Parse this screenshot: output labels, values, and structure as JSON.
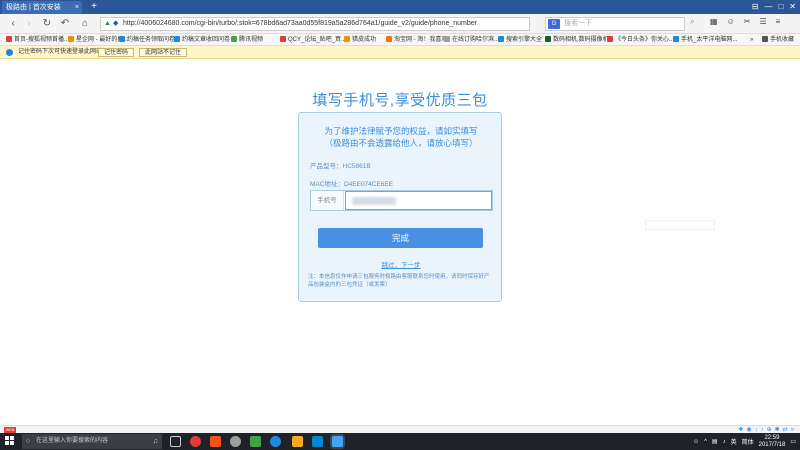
{
  "browser": {
    "tab_title": "极路由 | 首次安装",
    "tab_close": "×",
    "new_tab": "+",
    "url": "http://4006024680.com/cgi-bin/turbo/;stok=678bd6ad73aa0d55f819a5a286d764a1/guide_v2/guide/phone_number",
    "search_placeholder": "搜索一下",
    "search_engine": "G",
    "window_controls": [
      "⊟",
      "—",
      "□",
      "✕"
    ]
  },
  "bookmarks": [
    {
      "label": "首页-搜狐视频首播...",
      "color": "#e53935"
    },
    {
      "label": "星企网 - 最好的搜...",
      "color": "#fb8c00"
    },
    {
      "label": "约稿任务领取问卷",
      "color": "#1e88e5"
    },
    {
      "label": "约稿文章收回问卷",
      "color": "#1e88e5"
    },
    {
      "label": "腾讯视频",
      "color": "#43a047"
    },
    {
      "label": "QCY_论坛_贴吧_買...",
      "color": "#e53935"
    },
    {
      "label": "猎皮成功",
      "color": "#fb8c00"
    },
    {
      "label": "淘宝网 - 淘！我喜欢",
      "color": "#ff6d00"
    },
    {
      "label": "在线订购哈尔滨...",
      "color": "#9e9e9e"
    },
    {
      "label": "搜索引擎大全",
      "color": "#1e88e5"
    },
    {
      "label": "数码相机,数码摄像机...",
      "color": "#1b5e20"
    },
    {
      "label": "《今日头条》你关心...",
      "color": "#e53935"
    },
    {
      "label": "手机_太平洋电脑网...",
      "color": "#1e88e5"
    },
    {
      "label": "手机收藏",
      "color": "#555555"
    }
  ],
  "notification": {
    "message": "记住密码下次可快速登录此网站",
    "remember_button": "记住密码",
    "never_button": "此网站不记住"
  },
  "page": {
    "title": "填写手机号,享受优质三包",
    "notice_line1": "为了维护法律赋予您的权益，请如实填写",
    "notice_line2": "（极路由不会透露给他人，请放心填写）",
    "product_model": "产品型号：HC5861B",
    "mac_address": "MAC地址：D4EE074CE6EE",
    "phone_label": "手机号",
    "finish_button": "完成",
    "skip_link": "跳过，下一步",
    "footnote": "注：本信息仅作申请三包服务时极路由客服联系您时使用，请同时保存好产品包装盒内的三包凭证（或发票）"
  },
  "taskbar": {
    "search_placeholder": "在这里输入你要搜索的内容",
    "ime": "英",
    "lang": "简体",
    "time": "22:59",
    "date": "2017/7/18"
  },
  "statusbar": {
    "logo": "WEB"
  }
}
